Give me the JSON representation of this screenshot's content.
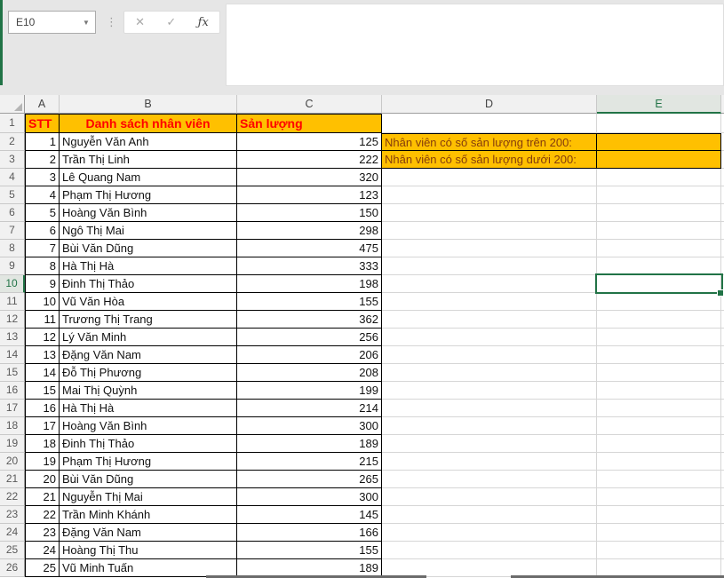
{
  "chrome": {
    "name_box": "E10",
    "dots_separator": "⋮",
    "cancel_icon": "✕",
    "enter_icon": "✓",
    "fx_icon": "ƒx",
    "formula_value": ""
  },
  "grid": {
    "column_letters": [
      "A",
      "B",
      "C",
      "D",
      "E"
    ],
    "row_numbers": [
      1,
      2,
      3,
      4,
      5,
      6,
      7,
      8,
      9,
      10,
      11,
      12,
      13,
      14,
      15,
      16,
      17,
      18,
      19,
      20,
      21,
      22,
      23,
      24,
      25,
      26
    ],
    "selected_cell": {
      "column": "E",
      "row": 10
    }
  },
  "table": {
    "header": {
      "stt": "STT",
      "name": "Danh sách nhân viên",
      "qty": "Sản lượng"
    },
    "rows": [
      {
        "stt": 1,
        "name": "Nguyễn Văn Anh",
        "qty": 125
      },
      {
        "stt": 2,
        "name": "Trần Thị Linh",
        "qty": 222
      },
      {
        "stt": 3,
        "name": "Lê Quang Nam",
        "qty": 320
      },
      {
        "stt": 4,
        "name": "Phạm Thị Hương",
        "qty": 123
      },
      {
        "stt": 5,
        "name": "Hoàng Văn Bình",
        "qty": 150
      },
      {
        "stt": 6,
        "name": "Ngô Thị Mai",
        "qty": 298
      },
      {
        "stt": 7,
        "name": "Bùi Văn Dũng",
        "qty": 475
      },
      {
        "stt": 8,
        "name": "Hà Thị Hà",
        "qty": 333
      },
      {
        "stt": 9,
        "name": "Đinh Thị Thảo",
        "qty": 198
      },
      {
        "stt": 10,
        "name": "Vũ Văn Hòa",
        "qty": 155
      },
      {
        "stt": 11,
        "name": "Trương Thị Trang",
        "qty": 362
      },
      {
        "stt": 12,
        "name": "Lý Văn Minh",
        "qty": 256
      },
      {
        "stt": 13,
        "name": "Đặng Văn Nam",
        "qty": 206
      },
      {
        "stt": 14,
        "name": "Đỗ Thị Phương",
        "qty": 208
      },
      {
        "stt": 15,
        "name": "Mai Thị Quỳnh",
        "qty": 199
      },
      {
        "stt": 16,
        "name": "Hà Thị Hà",
        "qty": 214
      },
      {
        "stt": 17,
        "name": "Hoàng Văn Bình",
        "qty": 300
      },
      {
        "stt": 18,
        "name": "Đinh Thị Thảo",
        "qty": 189
      },
      {
        "stt": 19,
        "name": "Phạm Thị Hương",
        "qty": 215
      },
      {
        "stt": 20,
        "name": "Bùi Văn Dũng",
        "qty": 265
      },
      {
        "stt": 21,
        "name": "Nguyễn Thị Mai",
        "qty": 300
      },
      {
        "stt": 22,
        "name": "Trần Minh Khánh",
        "qty": 145
      },
      {
        "stt": 23,
        "name": "Đặng Văn Nam",
        "qty": 166
      },
      {
        "stt": 24,
        "name": "Hoàng Thị Thu",
        "qty": 155
      },
      {
        "stt": 25,
        "name": "Vũ Minh Tuấn",
        "qty": 189
      }
    ]
  },
  "notes": [
    {
      "row": 2,
      "label": "Nhân viên có số sản lượng trên 200:"
    },
    {
      "row": 3,
      "label": "Nhân viên có số sản lượng dưới 200:"
    }
  ],
  "colors": {
    "accent_green": "#217346",
    "header_fill": "#FFC000",
    "header_text": "#FF0000",
    "note_text": "#843C0C"
  }
}
